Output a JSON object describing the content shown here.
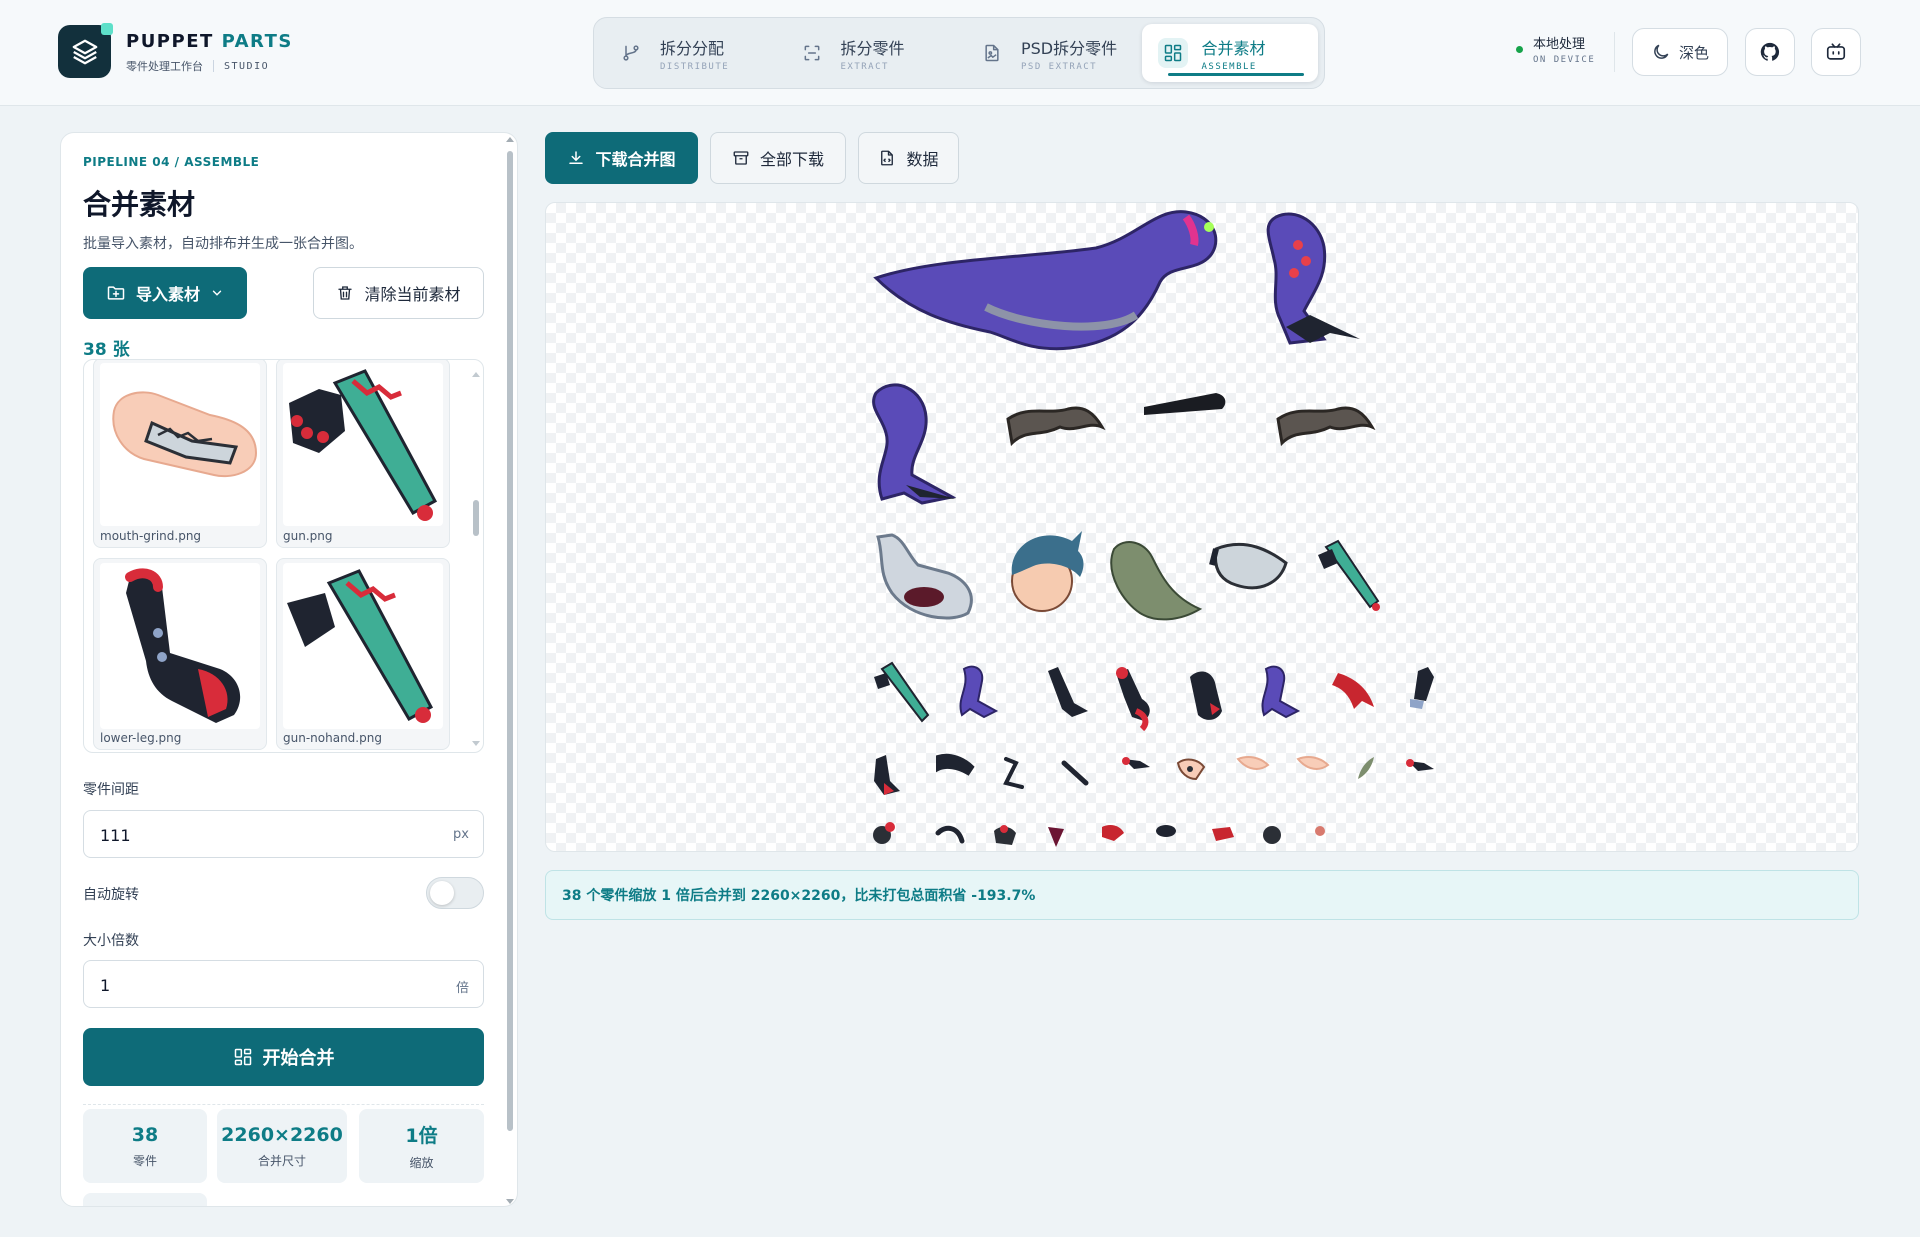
{
  "brand": {
    "name_a": "PUPPET",
    "name_b": "PARTS",
    "subtitle": "零件处理工作台",
    "studio": "STUDIO"
  },
  "nav": {
    "tabs": [
      {
        "label": "拆分分配",
        "sub": "DISTRIBUTE",
        "icon": "branch-icon",
        "active": false
      },
      {
        "label": "拆分零件",
        "sub": "EXTRACT",
        "icon": "scan-icon",
        "active": false
      },
      {
        "label": "PSD拆分零件",
        "sub": "PSD EXTRACT",
        "icon": "file-image-icon",
        "active": false
      },
      {
        "label": "合并素材",
        "sub": "ASSEMBLE",
        "icon": "assemble-icon",
        "active": true
      }
    ]
  },
  "header": {
    "local_label": "本地处理",
    "local_sub": "ON DEVICE",
    "theme_label": "深色"
  },
  "panel": {
    "eyebrow": "PIPELINE 04 / ASSEMBLE",
    "title": "合并素材",
    "description": "批量导入素材，自动排布并生成一张合并图。",
    "import_label": "导入素材",
    "clear_label": "清除当前素材",
    "count_label": "38 张",
    "files": [
      "mouth-grind.png",
      "gun.png",
      "lower-leg.png",
      "gun-nohand.png"
    ],
    "spacing_label": "零件间距",
    "spacing_value": "111",
    "spacing_unit": "px",
    "rotate_label": "自动旋转",
    "rotate_on": false,
    "scale_label": "大小倍数",
    "scale_value": "1",
    "scale_unit": "倍",
    "start_label": "开始合并",
    "stats": [
      {
        "value": "38",
        "label": "零件"
      },
      {
        "value": "2260×2260",
        "label": "合并尺寸"
      },
      {
        "value": "1倍",
        "label": "缩放"
      }
    ]
  },
  "actions": {
    "download_merged": "下载合并图",
    "download_all": "全部下载",
    "data": "数据"
  },
  "result": {
    "summary": "38 个零件缩放 1 倍后合并到 2260×2260，比未打包总面积省 -193.7%"
  },
  "colors": {
    "accent": "#0e7c86",
    "primary_button": "#0e6b78",
    "brand_dark": "#12303c"
  }
}
